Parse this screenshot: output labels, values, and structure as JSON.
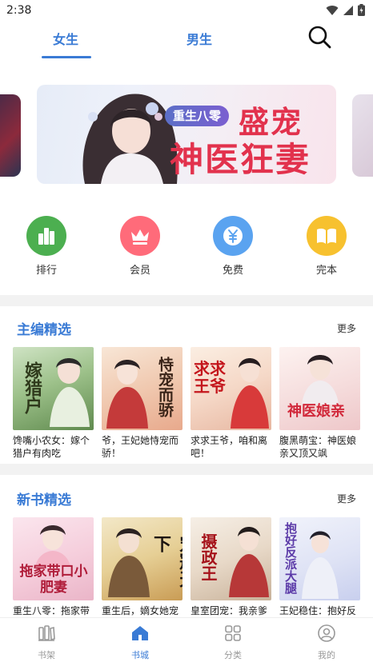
{
  "status_bar": {
    "time": "2:38"
  },
  "top_tabs": {
    "female": "女生",
    "male": "男生"
  },
  "banner": {
    "tag": "重生八零",
    "title_line1": "盛宠",
    "title_line2": "神医狂妻"
  },
  "quick_entries": [
    {
      "label": "排行",
      "color": "#4caf50"
    },
    {
      "label": "会员",
      "color": "#ff6b7a"
    },
    {
      "label": "免费",
      "color": "#5aa3f0"
    },
    {
      "label": "完本",
      "color": "#f7c12f"
    }
  ],
  "section_editor": {
    "title": "主编精选",
    "more": "更多",
    "books": [
      {
        "title": "馋嘴小农女：嫁个猎户有肉吃",
        "cover_text": "嫁猎户"
      },
      {
        "title": "爷，王妃她恃宠而骄！",
        "cover_text": "恃宠而骄"
      },
      {
        "title": "求求王爷，咱和离吧！",
        "cover_text": "求求王爷"
      },
      {
        "title": "腹黑萌宝：神医娘亲又顶又飒",
        "cover_text": "神医娘亲"
      }
    ]
  },
  "section_new": {
    "title": "新书精选",
    "more": "更多",
    "books": [
      {
        "title": "重生八零：拖家带口小肥妻",
        "cover_text": "拖家带口小肥妻"
      },
      {
        "title": "重生后，嫡女她宠冠天下",
        "cover_text": "宠冠天下"
      },
      {
        "title": "皇室团宠：我亲爹是摄政王",
        "cover_text": "摄政王"
      },
      {
        "title": "王妃稳住：抱好反派大腿苟住",
        "cover_text": "抱好反派大腿"
      }
    ]
  },
  "bottom_nav": [
    {
      "label": "书架",
      "active": false
    },
    {
      "label": "书城",
      "active": true
    },
    {
      "label": "分类",
      "active": false
    },
    {
      "label": "我的",
      "active": false
    }
  ]
}
